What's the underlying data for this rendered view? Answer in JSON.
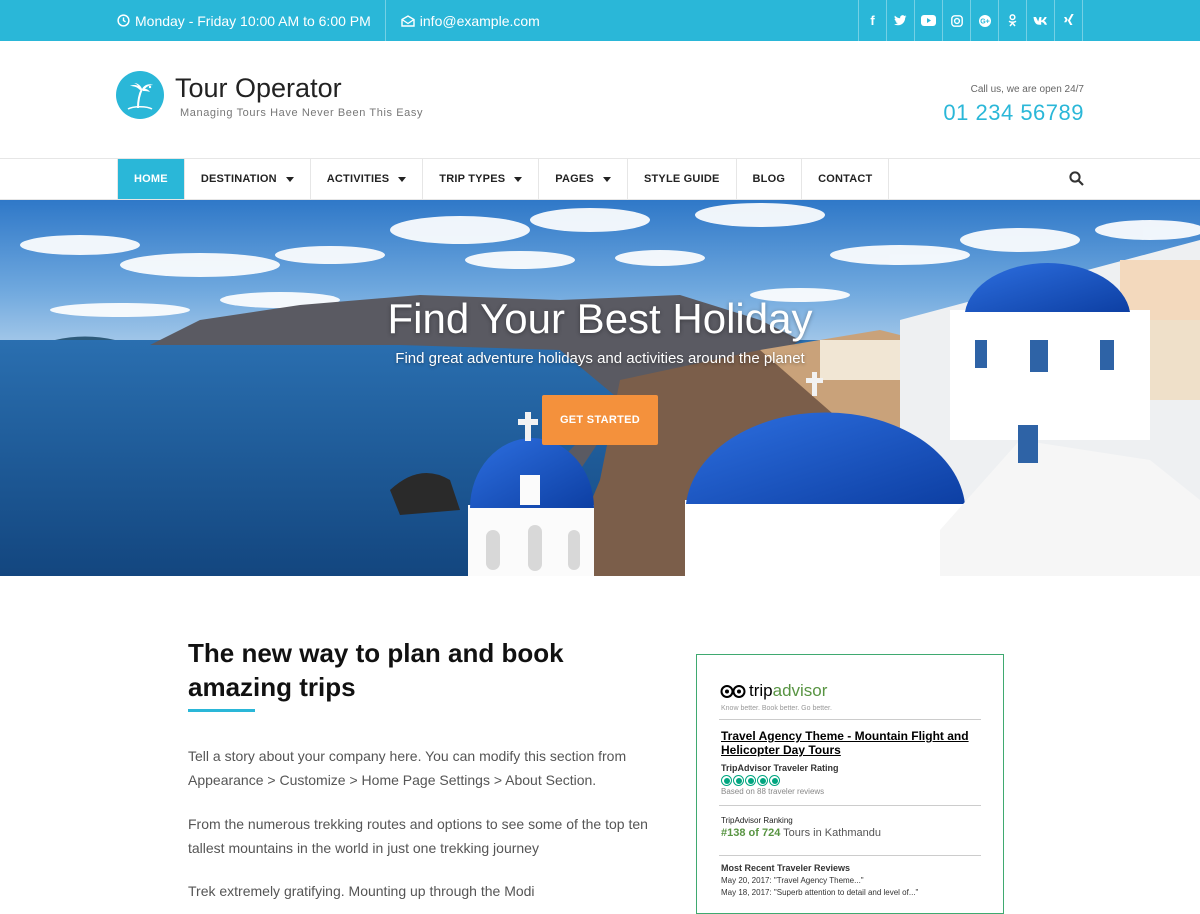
{
  "topbar": {
    "hours": "Monday - Friday 10:00 AM to 6:00 PM",
    "email": "info@example.com",
    "social_icons": [
      "facebook-icon",
      "twitter-icon",
      "youtube-icon",
      "instagram-icon",
      "google-plus-icon",
      "odnoklassniki-icon",
      "vk-icon",
      "xing-icon"
    ],
    "social_glyphs": [
      "f",
      "t",
      "▶",
      "◎",
      "G+",
      "ok",
      "vk",
      "x"
    ]
  },
  "header": {
    "title": "Tour Operator",
    "tagline": "Managing Tours Have Never Been This Easy",
    "call_note": "Call us, we are open 24/7",
    "phone": "01 234 56789"
  },
  "nav": {
    "items": [
      {
        "label": "HOME",
        "active": true,
        "dropdown": false
      },
      {
        "label": "DESTINATION",
        "active": false,
        "dropdown": true
      },
      {
        "label": "ACTIVITIES",
        "active": false,
        "dropdown": true
      },
      {
        "label": "TRIP TYPES",
        "active": false,
        "dropdown": true
      },
      {
        "label": "PAGES",
        "active": false,
        "dropdown": true
      },
      {
        "label": "STYLE GUIDE",
        "active": false,
        "dropdown": false
      },
      {
        "label": "BLOG",
        "active": false,
        "dropdown": false
      },
      {
        "label": "CONTACT",
        "active": false,
        "dropdown": false
      }
    ]
  },
  "hero": {
    "title": "Find Your Best Holiday",
    "subtitle": "Find great adventure holidays and activities around the planet",
    "button": "GET STARTED"
  },
  "about": {
    "title": "The new way to plan and book amazing trips",
    "p1": "Tell a story about your company here. You can modify this section from Appearance > Customize > Home Page Settings > About Section.",
    "p2": "From the numerous trekking routes and options to see some of the top ten tallest mountains in the world in just one trekking journey",
    "p3": "Trek extremely gratifying. Mounting up through the Modi"
  },
  "tripadvisor": {
    "logo_text_a": "trip",
    "logo_text_b": "advisor",
    "tagline": "Know better. Book better. Go better.",
    "listing": "Travel Agency Theme - Mountain Flight and Helicopter Day Tours",
    "rating_label": "TripAdvisor Traveler Rating",
    "rating_value": 5,
    "reviews_note": "Based on 88 traveler reviews",
    "ranking_label": "TripAdvisor Ranking",
    "ranking_hash": "#",
    "ranking_value": "138 of 724",
    "ranking_rest": " Tours in Kathmandu",
    "recent_label": "Most Recent Traveler Reviews",
    "review1": "May 20, 2017: \"Travel Agency Theme...\"",
    "review2": "May 18, 2017: \"Superb attention to detail and level of...\""
  }
}
